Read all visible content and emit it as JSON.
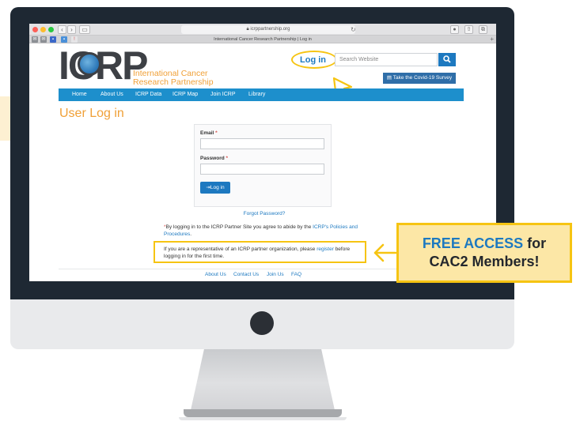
{
  "browser": {
    "url": "icrppartnership.org",
    "tab_title": "International Cancer Research Partnership | Log in",
    "back_label": "‹",
    "forward_label": "›",
    "reload_glyph": "↻",
    "new_tab_glyph": "+"
  },
  "site": {
    "logo_text": "ICRP",
    "logo_subtitle_1": "International Cancer",
    "logo_subtitle_2": "Research Partnership",
    "login_link": "Log in",
    "search_placeholder": "Search Website",
    "search_icon": "search-icon",
    "covid_button": "Take the Covid-19 Survey",
    "nav": {
      "items": [
        {
          "label": "Home"
        },
        {
          "label": "About Us"
        },
        {
          "label": "ICRP Data"
        },
        {
          "label": "ICRP Map"
        },
        {
          "label": "Join ICRP"
        },
        {
          "label": "Library"
        }
      ]
    },
    "page_title": "User Log in",
    "form": {
      "email_label": "Email",
      "password_label": "Password",
      "required_mark": "*",
      "email_value": "",
      "password_value": "",
      "login_button": "Log in"
    },
    "forgot_password": "Forgot Password?",
    "policy": {
      "asterisk": "*",
      "text": "By logging in to the ICRP Partner Site you agree to abide by the ",
      "link": "ICRP's Policies and Procedures",
      "end": "."
    },
    "representative": {
      "text_before": "If you are a representative of an ICRP partner organization, please ",
      "link": "register",
      "text_after": " before logging in for the first time."
    },
    "footer": {
      "links": [
        {
          "label": "About Us"
        },
        {
          "label": "Contact Us"
        },
        {
          "label": "Join Us"
        },
        {
          "label": "FAQ"
        }
      ]
    }
  },
  "callout": {
    "line1_accent": "FREE ACCESS",
    "line1_rest": " for",
    "line2": "CAC2 Members!"
  },
  "colors": {
    "brand_blue": "#1d79c0",
    "nav_blue": "#1d8fcc",
    "brand_orange": "#f0a037",
    "highlight_yellow": "#f6c412",
    "callout_fill": "#fce7a6",
    "bezel": "#1e2833"
  }
}
